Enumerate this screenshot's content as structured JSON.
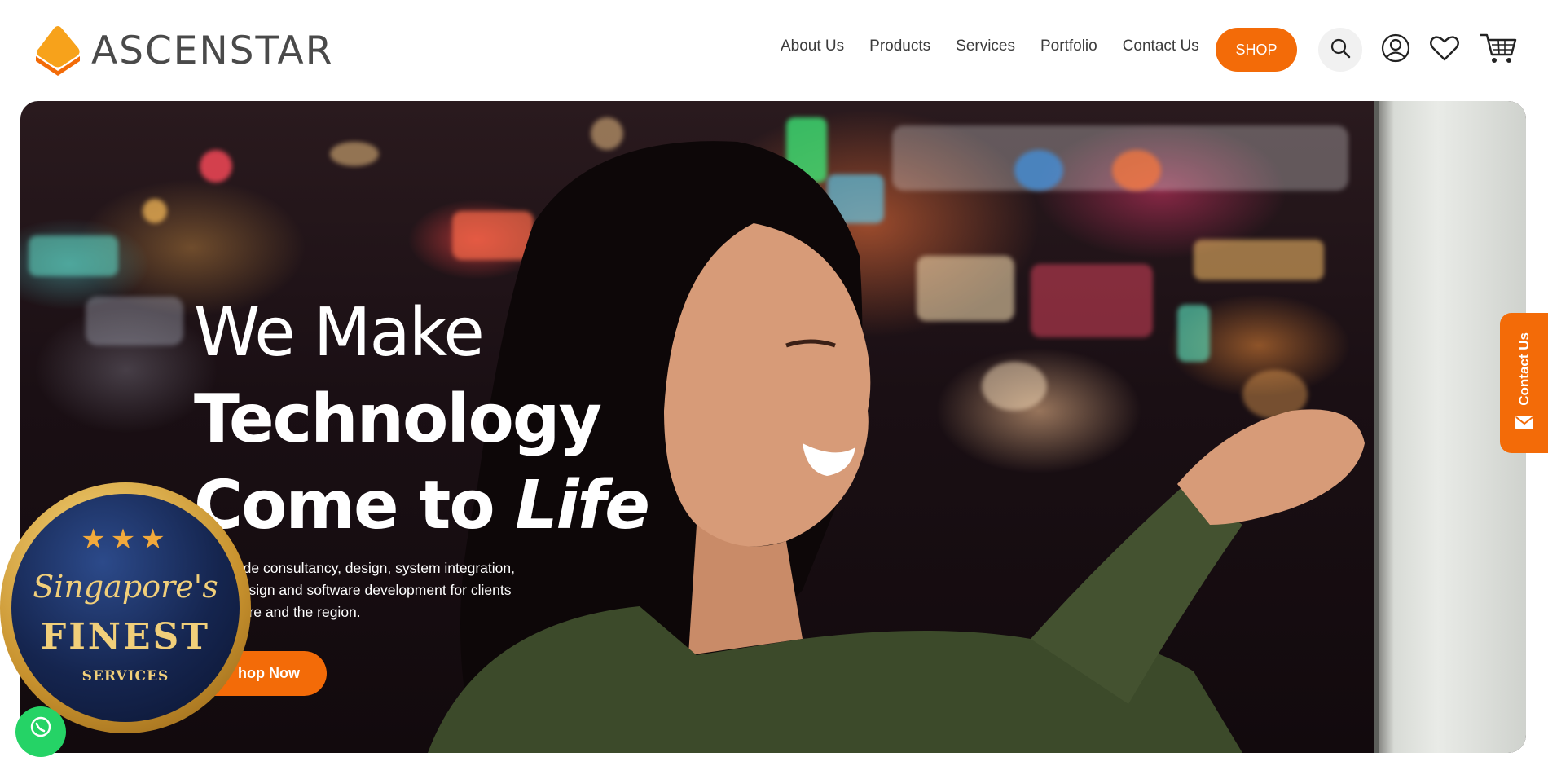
{
  "header": {
    "logo_text": "ASCENSTAR",
    "nav": [
      "About Us",
      "Products",
      "Services",
      "Portfolio",
      "Contact Us"
    ],
    "shop_label": "SHOP",
    "icons": [
      "search-icon",
      "user-icon",
      "heart-icon",
      "cart-icon"
    ]
  },
  "hero": {
    "headline_line1": "We Make",
    "headline_line2": "Technology",
    "headline_line3_plain": "Come to ",
    "headline_line3_italic": "Life",
    "subtext_line1": "vide consultancy, design, system integration,",
    "subtext_line2": "design and software development for clients",
    "subtext_line3": "pore and the region.",
    "cta_label": "hop Now"
  },
  "contact_tab": {
    "label": "Contact Us",
    "icon": "envelope-icon"
  },
  "badge": {
    "stars": "★★★",
    "script": "Singapore's",
    "finest": "FINEST",
    "services": "SERVICES"
  },
  "colors": {
    "accent": "#f36b08",
    "logo_orange": "#f7941d",
    "whatsapp": "#25d366"
  }
}
